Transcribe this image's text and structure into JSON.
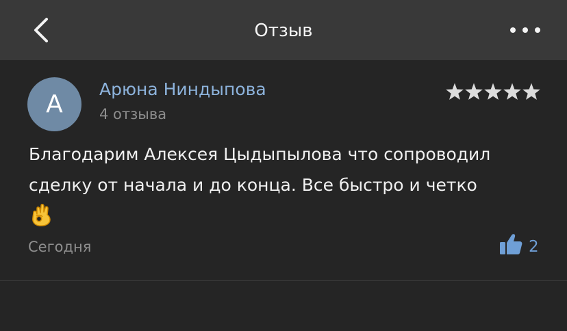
{
  "header": {
    "title": "Отзыв",
    "back_icon": "chevron-left-icon",
    "more_icon": "more-horizontal-icon"
  },
  "review": {
    "author": {
      "initial": "А",
      "name": "Арюна Ниндыпова",
      "reviews_count": "4 отзыва",
      "avatar_color": "#6f8aa5"
    },
    "rating": 5,
    "rating_max": 5,
    "text": "Благодарим Алексея Цыдыпылова что сопроводил сделку от начала и до конца. Все быстро и четко",
    "emoji": "ok-hand-icon",
    "date": "Сегодня",
    "likes": "2"
  },
  "colors": {
    "background": "#252525",
    "header_bg": "#393939",
    "accent": "#8db3dc",
    "like": "#6f9fd6",
    "muted": "#8e8e8e",
    "star": "#dcdcdc"
  }
}
